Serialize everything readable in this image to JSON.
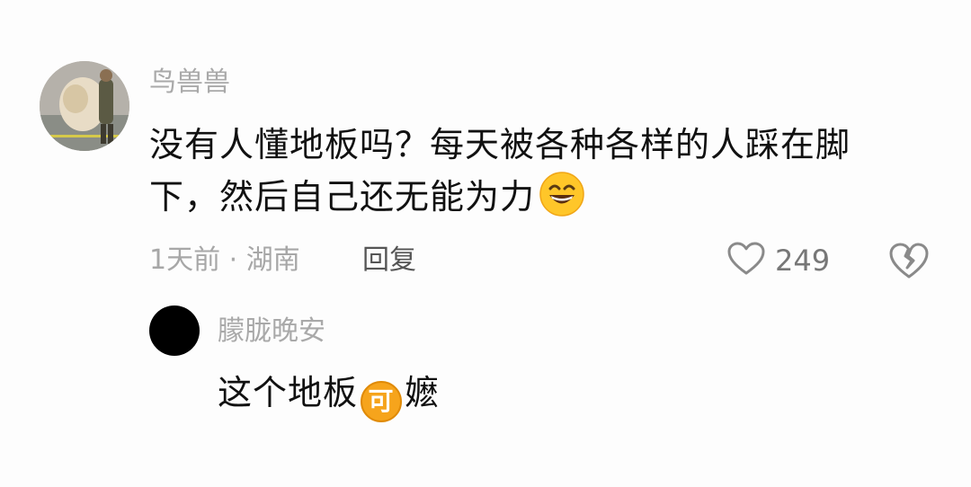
{
  "comment": {
    "username": "鸟兽兽",
    "text_line1": "没有人懂地板吗？每天被各种各样的人踩在脚",
    "text_line2": "下，然后自己还无能为力",
    "emoji": "grinning-face",
    "time_location": "1天前 · 湖南",
    "reply_label": "回复",
    "like_count": "249"
  },
  "reply": {
    "username": "朦胧晚安",
    "text_before": "这个地板",
    "sticker_text": "可",
    "text_after": "嬷"
  },
  "colors": {
    "background": "#fdfdfd",
    "username": "#a9a9a9",
    "text": "#111111",
    "sticker": "#f6a41c"
  }
}
